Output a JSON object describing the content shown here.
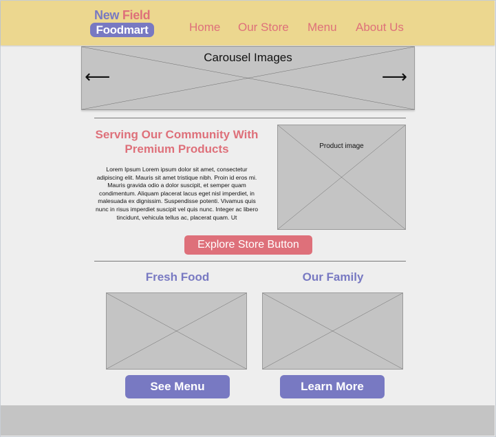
{
  "header": {
    "logo": {
      "word1": "New",
      "word2": "Field",
      "word3": "Foodmart"
    },
    "nav": [
      "Home",
      "Our Store",
      "Menu",
      "About Us"
    ]
  },
  "carousel": {
    "title": "Carousel Images",
    "prev_arrow": "⟵",
    "next_arrow": "⟶"
  },
  "intro": {
    "heading": "Serving Our Community With Premium Products",
    "body": "Lorem Ipsum Lorem ipsum dolor sit amet, consectetur adipiscing elit. Mauris sit amet tristique nibh. Proin id eros mi. Mauris gravida odio a dolor suscipit, et semper quam condimentum. Aliquam placerat lacus eget nisl imperdiet, in malesuada ex dignissim. Suspendisse potenti. Vivamus quis nunc in risus imperdiet suscipit vel quis nunc. Integer ac libero tincidunt, vehicula tellus ac, placerat quam. Ut",
    "product_image_label": "Product image",
    "button_label": "Explore Store Button"
  },
  "columns": [
    {
      "heading": "Fresh Food",
      "button_label": "See Menu"
    },
    {
      "heading": "Our Family",
      "button_label": "Learn More"
    }
  ],
  "colors": {
    "header_bg": "#ecd78f",
    "brand_pink": "#de707a",
    "brand_purple": "#7879c2",
    "placeholder_gray": "#c4c4c4",
    "page_bg": "#eeeeee"
  }
}
